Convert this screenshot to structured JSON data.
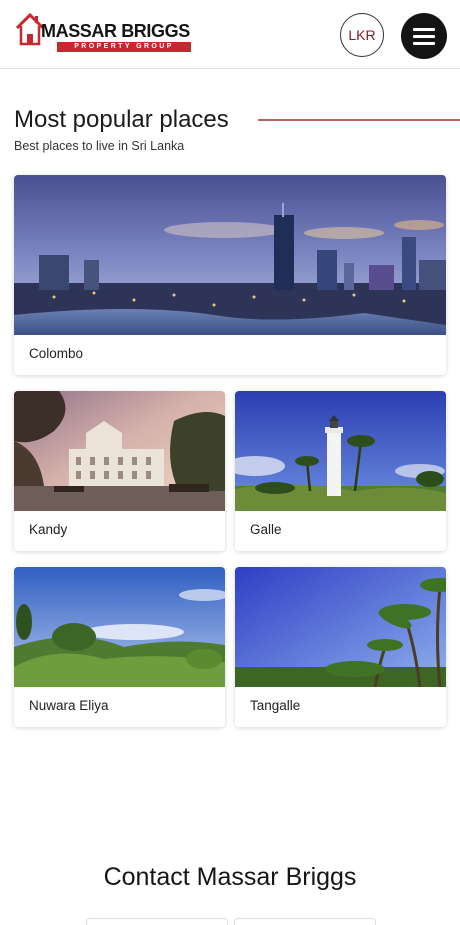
{
  "header": {
    "logo_title": "MASSAR BRIGGS",
    "logo_subtitle": "PROPERTY GROUP",
    "currency_label": "LKR",
    "menu_icon": "hamburger-menu-icon"
  },
  "popular": {
    "title": "Most popular places",
    "subtitle": "Best places to live in Sri Lanka",
    "places": [
      {
        "name": "Colombo"
      },
      {
        "name": "Kandy"
      },
      {
        "name": "Galle"
      },
      {
        "name": "Nuwara Eliya"
      },
      {
        "name": "Tangalle"
      }
    ]
  },
  "contact": {
    "title": "Contact Massar Briggs"
  },
  "colors": {
    "brand_red": "#c8272d",
    "currency_text": "#7a1f22",
    "divider_line": "#b4645e"
  }
}
